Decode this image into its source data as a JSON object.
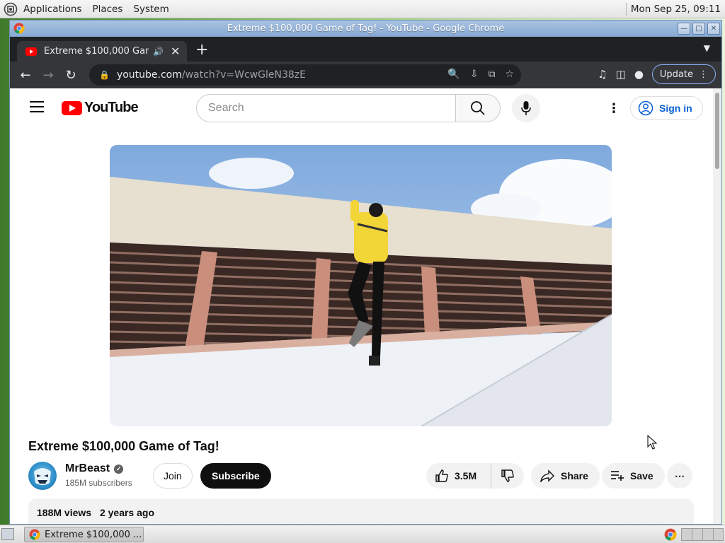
{
  "top_panel": {
    "menus": [
      "Applications",
      "Places",
      "System"
    ],
    "clock": "Mon Sep 25, 09:11"
  },
  "window": {
    "title": "Extreme $100,000 Game of Tag! - YouTube - Google Chrome"
  },
  "tab": {
    "title": "Extreme $100,000 Game of Tag!"
  },
  "toolbar": {
    "url_host": "youtube.com",
    "url_path": "/watch?v=WcwGleN38zE",
    "update_label": "Update"
  },
  "youtube": {
    "logo_text": "YouTube",
    "search_placeholder": "Search",
    "signin_label": "Sign in",
    "video_title": "Extreme $100,000 Game of Tag!",
    "channel_name": "MrBeast",
    "subscribers": "185M subscribers",
    "join_label": "Join",
    "subscribe_label": "Subscribe",
    "likes": "3.5M",
    "share_label": "Share",
    "save_label": "Save",
    "views": "188M views",
    "published": "2 years ago"
  },
  "taskbar": {
    "task_title": "Extreme $100,000 ..."
  },
  "colors": {
    "yt_red": "#ff0000",
    "link_blue": "#065fd4",
    "chrome_dark": "#35363a"
  }
}
